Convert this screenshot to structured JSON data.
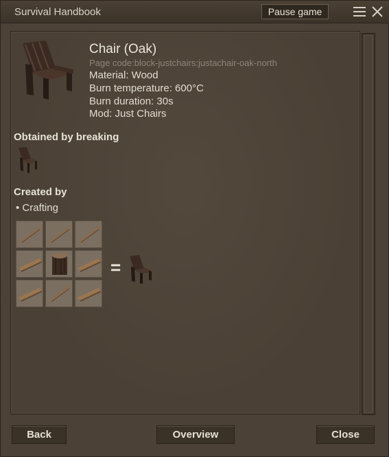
{
  "window": {
    "title": "Survival Handbook",
    "pause_label": "Pause game",
    "icons": [
      "menu-icon",
      "close-x-icon"
    ]
  },
  "item": {
    "name": "Chair (Oak)",
    "page_code": "Page code:block-justchairs:justachair-oak-north",
    "properties": [
      "Material: Wood",
      "Burn temperature: 600°C",
      "Burn duration: 30s",
      "Mod: Just Chairs"
    ],
    "icon": "chair-icon"
  },
  "obtained": {
    "heading": "Obtained by breaking",
    "icon": "chair-icon"
  },
  "created": {
    "heading": "Created by",
    "method": "• Crafting",
    "equals": "=",
    "grid_slots": [
      "stick-icon",
      "stick-icon",
      "stick-icon",
      "plank-icon",
      "oak-log-icon",
      "plank-icon",
      "plank-icon",
      "stick-icon",
      "plank-icon"
    ],
    "result_icon": "chair-icon"
  },
  "footer": {
    "back_label": "Back",
    "overview_label": "Overview",
    "close_label": "Close"
  },
  "colors": {
    "window_bg": "#4b4136",
    "panel_bg": "#4a4035",
    "button_bg": "#3a3127",
    "text": "#e8e2d6",
    "muted_text": "#8f857a",
    "slot_bg": "#7b6f62"
  }
}
